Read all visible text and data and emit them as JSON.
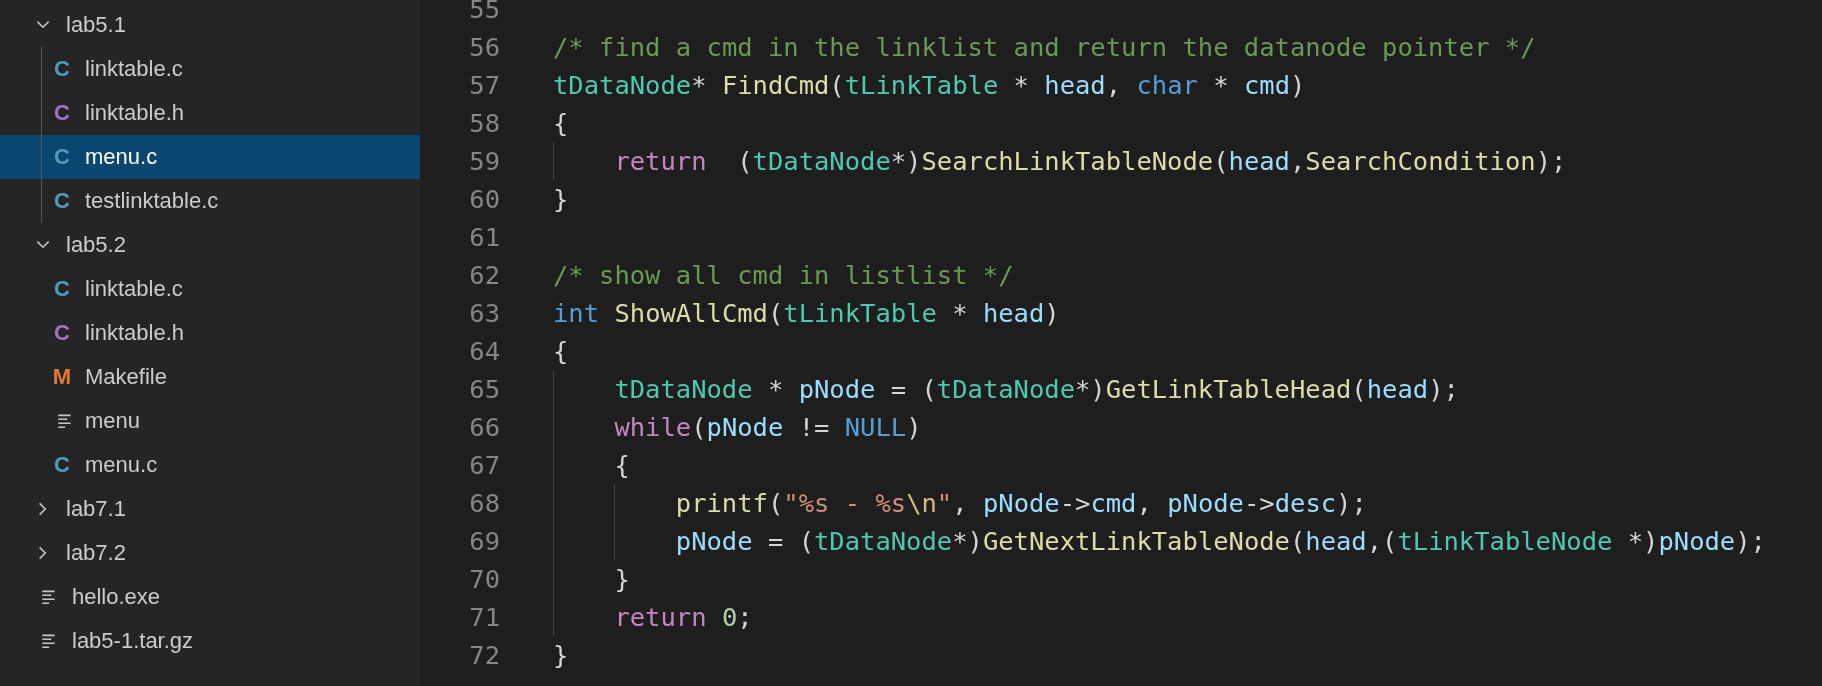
{
  "explorer": {
    "items": [
      {
        "kind": "folder",
        "label": "lab5.1",
        "expanded": true,
        "children": [
          {
            "kind": "c",
            "icon": "C",
            "label": "linktable.c",
            "selected": false
          },
          {
            "kind": "h",
            "icon": "C",
            "label": "linktable.h",
            "selected": false
          },
          {
            "kind": "c",
            "icon": "C",
            "label": "menu.c",
            "selected": true
          },
          {
            "kind": "c",
            "icon": "C",
            "label": "testlinktable.c",
            "selected": false
          }
        ]
      },
      {
        "kind": "folder",
        "label": "lab5.2",
        "expanded": true,
        "children": [
          {
            "kind": "c",
            "icon": "C",
            "label": "linktable.c",
            "selected": false
          },
          {
            "kind": "h",
            "icon": "C",
            "label": "linktable.h",
            "selected": false
          },
          {
            "kind": "makefile",
            "icon": "M",
            "label": "Makefile",
            "selected": false
          },
          {
            "kind": "text",
            "label": "menu",
            "selected": false
          },
          {
            "kind": "c",
            "icon": "C",
            "label": "menu.c",
            "selected": false
          }
        ]
      },
      {
        "kind": "folder",
        "label": "lab7.1",
        "expanded": false
      },
      {
        "kind": "folder",
        "label": "lab7.2",
        "expanded": false
      },
      {
        "kind": "text",
        "label": "hello.exe",
        "selected": false
      },
      {
        "kind": "text",
        "label": "lab5-1.tar.gz",
        "selected": false
      }
    ]
  },
  "editor": {
    "lines": [
      {
        "number": "55"
      },
      {
        "number": "56",
        "tokens": [
          {
            "kind": "comment",
            "text": "/* find a cmd in the linklist and return the datanode pointer */"
          }
        ]
      },
      {
        "number": "57",
        "tokens": [
          {
            "kind": "type",
            "text": "tDataNode"
          },
          {
            "kind": "plain",
            "text": "* "
          },
          {
            "kind": "function",
            "text": "FindCmd"
          },
          {
            "kind": "plain",
            "text": "("
          },
          {
            "kind": "type",
            "text": "tLinkTable"
          },
          {
            "kind": "plain",
            "text": " * "
          },
          {
            "kind": "variable",
            "text": "head"
          },
          {
            "kind": "plain",
            "text": ", "
          },
          {
            "kind": "keyword",
            "text": "char"
          },
          {
            "kind": "plain",
            "text": " * "
          },
          {
            "kind": "variable",
            "text": "cmd"
          },
          {
            "kind": "plain",
            "text": ")"
          }
        ]
      },
      {
        "number": "58",
        "tokens": [
          {
            "kind": "plain",
            "text": "{"
          }
        ]
      },
      {
        "number": "59",
        "kind": "block",
        "tokens": [
          {
            "kind": "control",
            "text": "return"
          },
          {
            "kind": "plain",
            "text": "  ("
          },
          {
            "kind": "type",
            "text": "tDataNode"
          },
          {
            "kind": "plain",
            "text": "*)"
          },
          {
            "kind": "function",
            "text": "SearchLinkTableNode"
          },
          {
            "kind": "plain",
            "text": "("
          },
          {
            "kind": "variable",
            "text": "head"
          },
          {
            "kind": "plain",
            "text": ","
          },
          {
            "kind": "function",
            "text": "SearchCondition"
          },
          {
            "kind": "plain",
            "text": ");"
          }
        ]
      },
      {
        "number": "60",
        "tokens": [
          {
            "kind": "plain",
            "text": "}"
          }
        ]
      },
      {
        "number": "61"
      },
      {
        "number": "62",
        "tokens": [
          {
            "kind": "comment",
            "text": "/* show all cmd in listlist */"
          }
        ]
      },
      {
        "number": "63",
        "tokens": [
          {
            "kind": "keyword",
            "text": "int "
          },
          {
            "kind": "function",
            "text": "ShowAllCmd"
          },
          {
            "kind": "plain",
            "text": "("
          },
          {
            "kind": "type",
            "text": "tLinkTable"
          },
          {
            "kind": "plain",
            "text": " * "
          },
          {
            "kind": "variable",
            "text": "head"
          },
          {
            "kind": "plain",
            "text": ")"
          }
        ]
      },
      {
        "number": "64",
        "tokens": [
          {
            "kind": "plain",
            "text": "{"
          }
        ]
      },
      {
        "number": "65",
        "kind": "block",
        "tokens": [
          {
            "kind": "type",
            "text": "tDataNode"
          },
          {
            "kind": "plain",
            "text": " * "
          },
          {
            "kind": "variable",
            "text": "pNode"
          },
          {
            "kind": "plain",
            "text": " = ("
          },
          {
            "kind": "type",
            "text": "tDataNode"
          },
          {
            "kind": "plain",
            "text": "*)"
          },
          {
            "kind": "function",
            "text": "GetLinkTableHead"
          },
          {
            "kind": "plain",
            "text": "("
          },
          {
            "kind": "variable",
            "text": "head"
          },
          {
            "kind": "plain",
            "text": ");"
          }
        ]
      },
      {
        "number": "66",
        "kind": "block",
        "tokens": [
          {
            "kind": "control",
            "text": "while"
          },
          {
            "kind": "plain",
            "text": "("
          },
          {
            "kind": "variable",
            "text": "pNode"
          },
          {
            "kind": "plain",
            "text": " != "
          },
          {
            "kind": "keyword",
            "text": "NULL"
          },
          {
            "kind": "plain",
            "text": ")"
          }
        ]
      },
      {
        "number": "67",
        "kind": "block",
        "tokens": [
          {
            "kind": "plain",
            "text": "{"
          }
        ]
      },
      {
        "number": "68",
        "kind": "inner",
        "tokens": [
          {
            "kind": "function",
            "text": "printf"
          },
          {
            "kind": "plain",
            "text": "("
          },
          {
            "kind": "string",
            "text": "\"%s - %s"
          },
          {
            "kind": "escape",
            "text": "\\n"
          },
          {
            "kind": "string",
            "text": "\""
          },
          {
            "kind": "plain",
            "text": ", "
          },
          {
            "kind": "variable",
            "text": "pNode"
          },
          {
            "kind": "plain",
            "text": "->"
          },
          {
            "kind": "variable",
            "text": "cmd"
          },
          {
            "kind": "plain",
            "text": ", "
          },
          {
            "kind": "variable",
            "text": "pNode"
          },
          {
            "kind": "plain",
            "text": "->"
          },
          {
            "kind": "variable",
            "text": "desc"
          },
          {
            "kind": "plain",
            "text": ");"
          }
        ]
      },
      {
        "number": "69",
        "kind": "inner",
        "tokens": [
          {
            "kind": "variable",
            "text": "pNode"
          },
          {
            "kind": "plain",
            "text": " = ("
          },
          {
            "kind": "type",
            "text": "tDataNode"
          },
          {
            "kind": "plain",
            "text": "*)"
          },
          {
            "kind": "function",
            "text": "GetNextLinkTableNode"
          },
          {
            "kind": "plain",
            "text": "("
          },
          {
            "kind": "variable",
            "text": "head"
          },
          {
            "kind": "plain",
            "text": ",("
          },
          {
            "kind": "type",
            "text": "tLinkTableNode"
          },
          {
            "kind": "plain",
            "text": " *)"
          },
          {
            "kind": "variable",
            "text": "pNode"
          },
          {
            "kind": "plain",
            "text": ");"
          }
        ]
      },
      {
        "number": "70",
        "kind": "block",
        "tokens": [
          {
            "kind": "plain",
            "text": "}"
          }
        ]
      },
      {
        "number": "71",
        "kind": "block",
        "tokens": [
          {
            "kind": "control",
            "text": "return "
          },
          {
            "kind": "number",
            "text": "0"
          },
          {
            "kind": "plain",
            "text": ";"
          }
        ]
      },
      {
        "number": "72",
        "tokens": [
          {
            "kind": "plain",
            "text": "}"
          }
        ]
      }
    ]
  }
}
